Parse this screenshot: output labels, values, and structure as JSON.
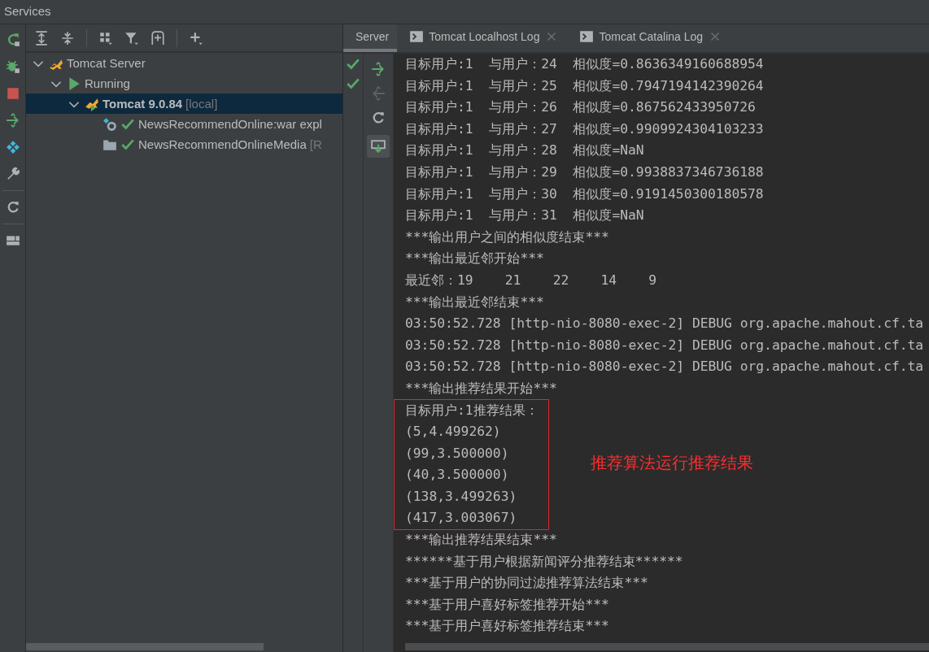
{
  "window": {
    "title": "Services"
  },
  "tree": [
    {
      "label": "Tomcat Server",
      "kind": "server",
      "expanded": true,
      "selected": false,
      "children": [
        {
          "label": "Running",
          "kind": "status",
          "expanded": true,
          "selected": false,
          "children": [
            {
              "label": "Tomcat 9.0.84",
              "suffix": "[local]",
              "kind": "instance",
              "expanded": true,
              "selected": true,
              "children": [
                {
                  "label": "NewsRecommendOnline:war expl",
                  "kind": "artifact",
                  "selected": false,
                  "deployed": true
                },
                {
                  "label": "NewsRecommendOnlineMedia",
                  "suffix": "[R",
                  "kind": "folder",
                  "selected": false,
                  "deployed": true
                }
              ]
            }
          ]
        }
      ]
    }
  ],
  "tabs": [
    {
      "label": "Server",
      "kind": "server",
      "selected": true,
      "closable": false
    },
    {
      "label": "Tomcat Localhost Log",
      "kind": "log",
      "selected": false,
      "closable": true
    },
    {
      "label": "Tomcat Catalina Log",
      "kind": "log",
      "selected": false,
      "closable": true
    }
  ],
  "console": {
    "lines": [
      {
        "text": "目标用户:1  与用户：24  相似度=0.8636349160688954",
        "highlighted": false
      },
      {
        "text": "目标用户:1  与用户：25  相似度=0.7947194142390264",
        "highlighted": false
      },
      {
        "text": "目标用户:1  与用户：26  相似度=0.867562433950726",
        "highlighted": false
      },
      {
        "text": "目标用户:1  与用户：27  相似度=0.9909924304103233",
        "highlighted": false
      },
      {
        "text": "目标用户:1  与用户：28  相似度=NaN",
        "highlighted": false
      },
      {
        "text": "目标用户:1  与用户：29  相似度=0.9938837346736188",
        "highlighted": false
      },
      {
        "text": "目标用户:1  与用户：30  相似度=0.9191450300180578",
        "highlighted": false
      },
      {
        "text": "目标用户:1  与用户：31  相似度=NaN",
        "highlighted": false
      },
      {
        "text": "***输出用户之间的相似度结束***",
        "highlighted": false
      },
      {
        "text": "***输出最近邻开始***",
        "highlighted": false
      },
      {
        "text": "最近邻：19    21    22    14    9",
        "highlighted": false
      },
      {
        "text": "***输出最近邻结束***",
        "highlighted": false
      },
      {
        "text": "03:50:52.728 [http-nio-8080-exec-2] DEBUG org.apache.mahout.cf.ta",
        "highlighted": false
      },
      {
        "text": "03:50:52.728 [http-nio-8080-exec-2] DEBUG org.apache.mahout.cf.ta",
        "highlighted": false
      },
      {
        "text": "03:50:52.728 [http-nio-8080-exec-2] DEBUG org.apache.mahout.cf.ta",
        "highlighted": false
      },
      {
        "text": "***输出推荐结果开始***",
        "highlighted": false
      },
      {
        "text": "目标用户:1推荐结果：",
        "highlighted": true
      },
      {
        "text": "(5,4.499262)",
        "highlighted": true
      },
      {
        "text": "(99,3.500000)",
        "highlighted": true
      },
      {
        "text": "(40,3.500000)",
        "highlighted": true
      },
      {
        "text": "(138,3.499263)",
        "highlighted": true
      },
      {
        "text": "(417,3.003067)",
        "highlighted": true
      },
      {
        "text": "***输出推荐结果结束***",
        "highlighted": false
      },
      {
        "text": "******基于用户根据新闻评分推荐结束******",
        "highlighted": false
      },
      {
        "text": "***基于用户的协同过滤推荐算法结束***",
        "highlighted": false
      },
      {
        "text": "***基于用户喜好标签推荐开始***",
        "highlighted": false
      },
      {
        "text": "***基于用户喜好标签推荐结束***",
        "highlighted": false
      }
    ],
    "annotation": "推荐算法运行推荐结果"
  }
}
